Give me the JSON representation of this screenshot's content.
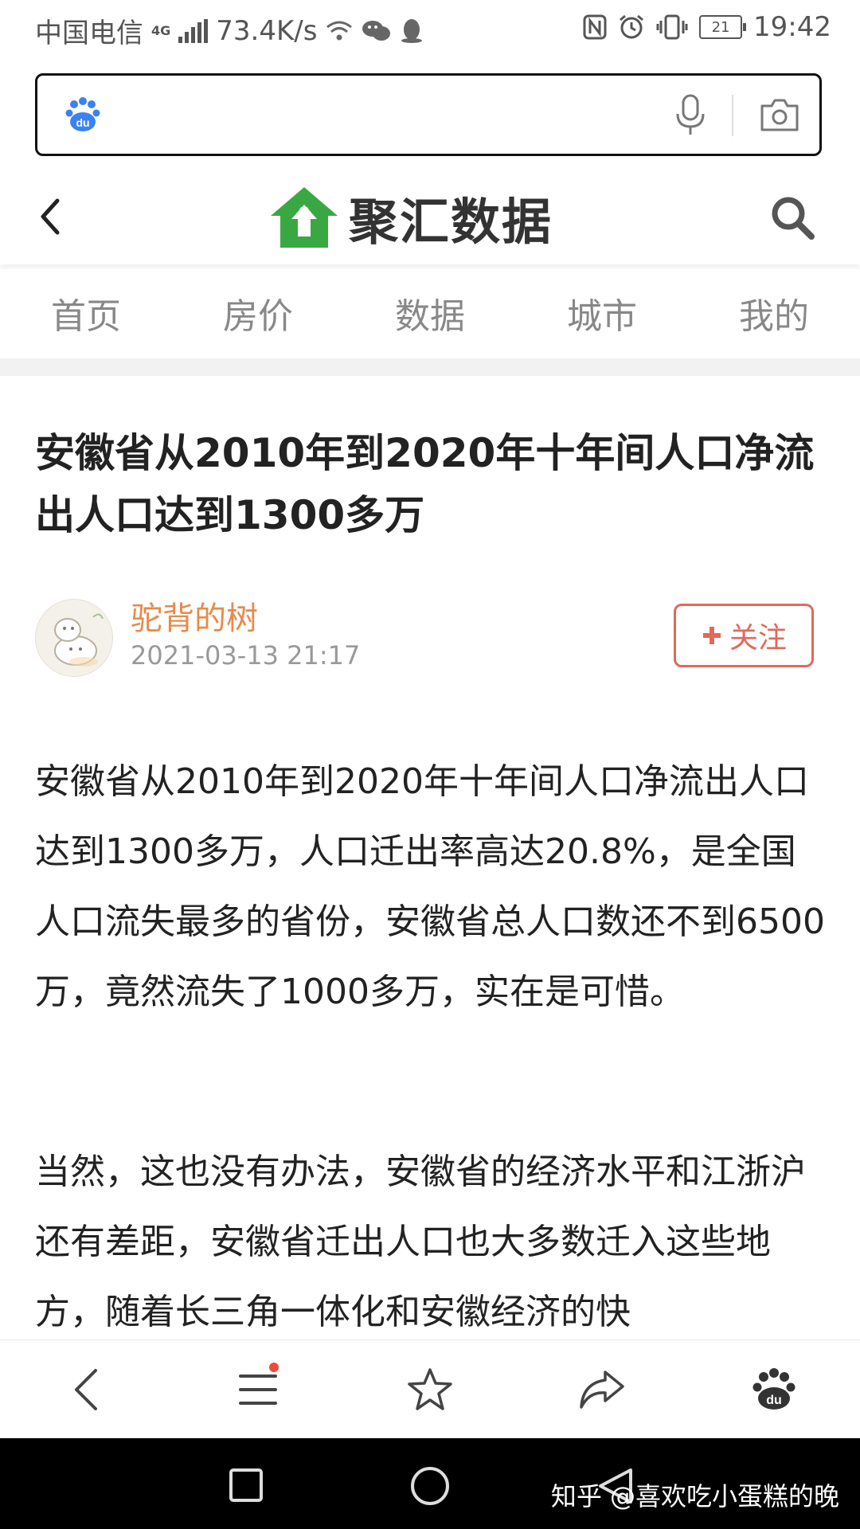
{
  "status_bar": {
    "carrier": "中国电信",
    "network": "4G",
    "speed": "73.4K/s",
    "battery": "21",
    "time": "19:42"
  },
  "search_bar": {
    "logo": "du"
  },
  "header": {
    "brand": "聚汇数据"
  },
  "nav": {
    "items": [
      "首页",
      "房价",
      "数据",
      "城市",
      "我的"
    ]
  },
  "article": {
    "title": "安徽省从2010年到2020年十年间人口净流出人口达到1300多万",
    "author": "驼背的树",
    "date": "2021-03-13 21:17",
    "follow_label": "关注",
    "paragraphs": [
      "安徽省从2010年到2020年十年间人口净流出人口达到1300多万，人口迁出率高达20.8%，是全国人口流失最多的省份，安徽省总人口数还不到6500万，竟然流失了1000多万，实在是可惜。",
      "当然，这也没有办法，安徽省的经济水平和江浙沪还有差距，安徽省迁出人口也大多数迁入这些地方，随着长三角一体化和安徽经济的快"
    ]
  },
  "toolbar": {
    "icons": [
      "back-icon",
      "menu-icon",
      "star-icon",
      "share-icon",
      "baidu-icon"
    ]
  },
  "watermark": "知乎 @喜欢吃小蛋糕的晚",
  "colors": {
    "author": "#e98a4a",
    "follow": "#e06a5c",
    "brand_green": "#3aa842",
    "baidu_blue": "#3b82f0"
  }
}
